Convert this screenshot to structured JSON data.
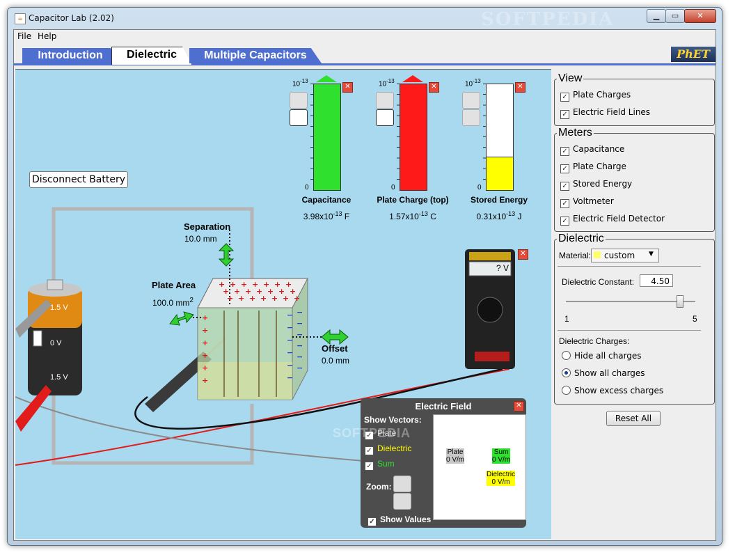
{
  "window": {
    "title": "Capacitor Lab (2.02)",
    "watermark": "SOFTPEDIA"
  },
  "menu": {
    "file": "File",
    "help": "Help"
  },
  "tabs": [
    {
      "label": "Introduction"
    },
    {
      "label": "Dielectric"
    },
    {
      "label": "Multiple Capacitors"
    }
  ],
  "logo": "PhET",
  "sim": {
    "disconnect_battery": "Disconnect Battery",
    "battery": {
      "top": "1.5 V",
      "mid": "0 V",
      "bottom": "1.5 V"
    },
    "separation": {
      "label": "Separation",
      "value": "10.0 mm"
    },
    "plate_area": {
      "label": "Plate Area",
      "value": "100.0 mm",
      "sup": "2"
    },
    "offset": {
      "label": "Offset",
      "value": "0.0 mm"
    },
    "voltmeter": {
      "reading": "? V"
    },
    "meters": [
      {
        "name": "Capacitance",
        "exp_top": "10",
        "exp_top_sup": "-13",
        "zero": "0",
        "value": "3.98x10",
        "value_sup": "-13",
        "unit": "F",
        "fill": 1.0,
        "color": "#2fe02f",
        "arrow": "#2fe02f"
      },
      {
        "name": "Plate Charge (top)",
        "exp_top": "10",
        "exp_top_sup": "-13",
        "zero": "0",
        "value": "1.57x10",
        "value_sup": "-13",
        "unit": "C",
        "fill": 1.0,
        "color": "#ff1a1a",
        "arrow": "#ff1a1a"
      },
      {
        "name": "Stored Energy",
        "exp_top": "10",
        "exp_top_sup": "-13",
        "zero": "0",
        "value": "0.31x10",
        "value_sup": "-13",
        "unit": "J",
        "fill": 0.31,
        "color": "#ffff00",
        "arrow": ""
      }
    ]
  },
  "electric_field": {
    "title": "Electric Field",
    "show_vectors": "Show Vectors:",
    "plate": "Plate",
    "dielectric": "Dielectric",
    "sum": "Sum",
    "zoom": "Zoom:",
    "show_values": "Show Values",
    "vals": {
      "plate_name": "Plate",
      "plate_val": "0 V/m",
      "sum_name": "Sum",
      "sum_val": "0 V/m",
      "diel_name": "Dielectric",
      "diel_val": "0 V/m"
    },
    "watermark": "SOFTPEDIA"
  },
  "panel": {
    "view": {
      "title": "View",
      "items": [
        "Plate Charges",
        "Electric Field Lines"
      ]
    },
    "meters": {
      "title": "Meters",
      "items": [
        "Capacitance",
        "Plate Charge",
        "Stored Energy",
        "Voltmeter",
        "Electric Field Detector"
      ]
    },
    "dielectric": {
      "title": "Dielectric",
      "material_label": "Material:",
      "material_value": "custom",
      "constant_label": "Dielectric Constant:",
      "constant_value": "4.50",
      "slider_min": "1",
      "slider_max": "5",
      "slider_fraction": 0.875,
      "charges_label": "Dielectric Charges:",
      "charge_options": [
        "Hide all charges",
        "Show all charges",
        "Show excess charges"
      ],
      "selected_option": 1
    },
    "reset": "Reset All"
  }
}
